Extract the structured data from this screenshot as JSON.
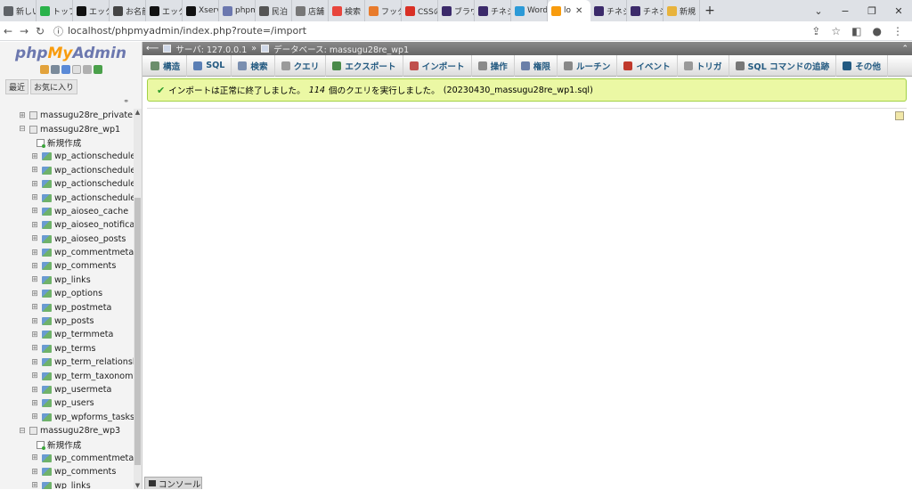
{
  "browser": {
    "tabs": [
      {
        "label": "新しい",
        "color": "#5f6368",
        "active": false
      },
      {
        "label": "トップ",
        "color": "#2ab24a",
        "active": false
      },
      {
        "label": "エック",
        "color": "#111111",
        "active": false
      },
      {
        "label": "お名前",
        "color": "#444444",
        "active": false
      },
      {
        "label": "エック",
        "color": "#111111",
        "active": false
      },
      {
        "label": "Xserv",
        "color": "#111111",
        "active": false
      },
      {
        "label": "phpm",
        "color": "#6c78af",
        "active": false
      },
      {
        "label": "民泊",
        "color": "#555555",
        "active": false
      },
      {
        "label": "店舗",
        "color": "#777777",
        "active": false
      },
      {
        "label": "検索",
        "color": "#e8453c",
        "active": false
      },
      {
        "label": "フッタ",
        "color": "#e87b2c",
        "active": false
      },
      {
        "label": "CSSの",
        "color": "#d93025",
        "active": false
      },
      {
        "label": "ブラウ",
        "color": "#3b2a6a",
        "active": false
      },
      {
        "label": "チネジ",
        "color": "#3b2a6a",
        "active": false
      },
      {
        "label": "Word",
        "color": "#2c9ad7",
        "active": false
      },
      {
        "label": "lo",
        "color": "#f89c0e",
        "active": true
      },
      {
        "label": "チネジ",
        "color": "#3b2a6a",
        "active": false
      },
      {
        "label": "チネジ",
        "color": "#3b2a6a",
        "active": false
      },
      {
        "label": "新規",
        "color": "#e8b33c",
        "active": false
      }
    ],
    "new_tab": "+",
    "window_controls": [
      "⌄",
      "−",
      "❐",
      "✕"
    ],
    "url": "localhost/phpmyadmin/index.php?route=/import"
  },
  "sidebar": {
    "logo": {
      "php": "php",
      "my": "My",
      "admin": "Admin"
    },
    "nav_tabs": [
      "最近",
      "お気に入り"
    ],
    "tree": [
      {
        "label": "massugu28re_private",
        "level": 0,
        "kind": "db",
        "ctl": "⊞"
      },
      {
        "label": "massugu28re_wp1",
        "level": 0,
        "kind": "db",
        "ctl": "⊟"
      },
      {
        "label": "新規作成",
        "level": 1,
        "kind": "new",
        "ctl": ""
      },
      {
        "label": "wp_actionscheduler_",
        "level": 1,
        "kind": "table",
        "ctl": "⊞"
      },
      {
        "label": "wp_actionscheduler_",
        "level": 1,
        "kind": "table",
        "ctl": "⊞"
      },
      {
        "label": "wp_actionscheduler_",
        "level": 1,
        "kind": "table",
        "ctl": "⊞"
      },
      {
        "label": "wp_actionscheduler_",
        "level": 1,
        "kind": "table",
        "ctl": "⊞"
      },
      {
        "label": "wp_aioseo_cache",
        "level": 1,
        "kind": "table",
        "ctl": "⊞"
      },
      {
        "label": "wp_aioseo_notificatio",
        "level": 1,
        "kind": "table",
        "ctl": "⊞"
      },
      {
        "label": "wp_aioseo_posts",
        "level": 1,
        "kind": "table",
        "ctl": "⊞"
      },
      {
        "label": "wp_commentmeta",
        "level": 1,
        "kind": "table",
        "ctl": "⊞"
      },
      {
        "label": "wp_comments",
        "level": 1,
        "kind": "table",
        "ctl": "⊞"
      },
      {
        "label": "wp_links",
        "level": 1,
        "kind": "table",
        "ctl": "⊞"
      },
      {
        "label": "wp_options",
        "level": 1,
        "kind": "table",
        "ctl": "⊞"
      },
      {
        "label": "wp_postmeta",
        "level": 1,
        "kind": "table",
        "ctl": "⊞"
      },
      {
        "label": "wp_posts",
        "level": 1,
        "kind": "table",
        "ctl": "⊞"
      },
      {
        "label": "wp_termmeta",
        "level": 1,
        "kind": "table",
        "ctl": "⊞"
      },
      {
        "label": "wp_terms",
        "level": 1,
        "kind": "table",
        "ctl": "⊞"
      },
      {
        "label": "wp_term_relationshi",
        "level": 1,
        "kind": "table",
        "ctl": "⊞"
      },
      {
        "label": "wp_term_taxonomy",
        "level": 1,
        "kind": "table",
        "ctl": "⊞"
      },
      {
        "label": "wp_usermeta",
        "level": 1,
        "kind": "table",
        "ctl": "⊞"
      },
      {
        "label": "wp_users",
        "level": 1,
        "kind": "table",
        "ctl": "⊞"
      },
      {
        "label": "wp_wpforms_tasks_",
        "level": 1,
        "kind": "table",
        "ctl": "⊞"
      },
      {
        "label": "massugu28re_wp3",
        "level": 0,
        "kind": "db",
        "ctl": "⊟"
      },
      {
        "label": "新規作成",
        "level": 1,
        "kind": "new",
        "ctl": ""
      },
      {
        "label": "wp_commentmeta",
        "level": 1,
        "kind": "table",
        "ctl": "⊞"
      },
      {
        "label": "wp_comments",
        "level": 1,
        "kind": "table",
        "ctl": "⊞"
      },
      {
        "label": "wp_links",
        "level": 1,
        "kind": "table",
        "ctl": "⊞"
      }
    ]
  },
  "breadcrumb": {
    "server": "サーバ: 127.0.0.1",
    "separator": "»",
    "database": "データベース: massugu28re_wp1"
  },
  "menu": [
    {
      "label": "構造",
      "color": "#6b8e6b"
    },
    {
      "label": "SQL",
      "color": "#5b7fb5"
    },
    {
      "label": "検索",
      "color": "#7a8fb0"
    },
    {
      "label": "クエリ",
      "color": "#9a9a9a"
    },
    {
      "label": "エクスポート",
      "color": "#4a8a4a"
    },
    {
      "label": "インポート",
      "color": "#c0504d"
    },
    {
      "label": "操作",
      "color": "#8a8a8a"
    },
    {
      "label": "権限",
      "color": "#6a7fa8"
    },
    {
      "label": "ルーチン",
      "color": "#888888"
    },
    {
      "label": "イベント",
      "color": "#c0392b"
    },
    {
      "label": "トリガ",
      "color": "#999999"
    },
    {
      "label": "SQL コマンドの追跡",
      "color": "#777777"
    },
    {
      "label": "その他",
      "color": "#235a81"
    }
  ],
  "message": {
    "prefix": "インポートは正常に終了しました。",
    "count": "114",
    "middle": "個のクエリを実行しました。",
    "file": "(20230430_massugu28re_wp1.sql)"
  },
  "console": {
    "label": "コンソール"
  }
}
